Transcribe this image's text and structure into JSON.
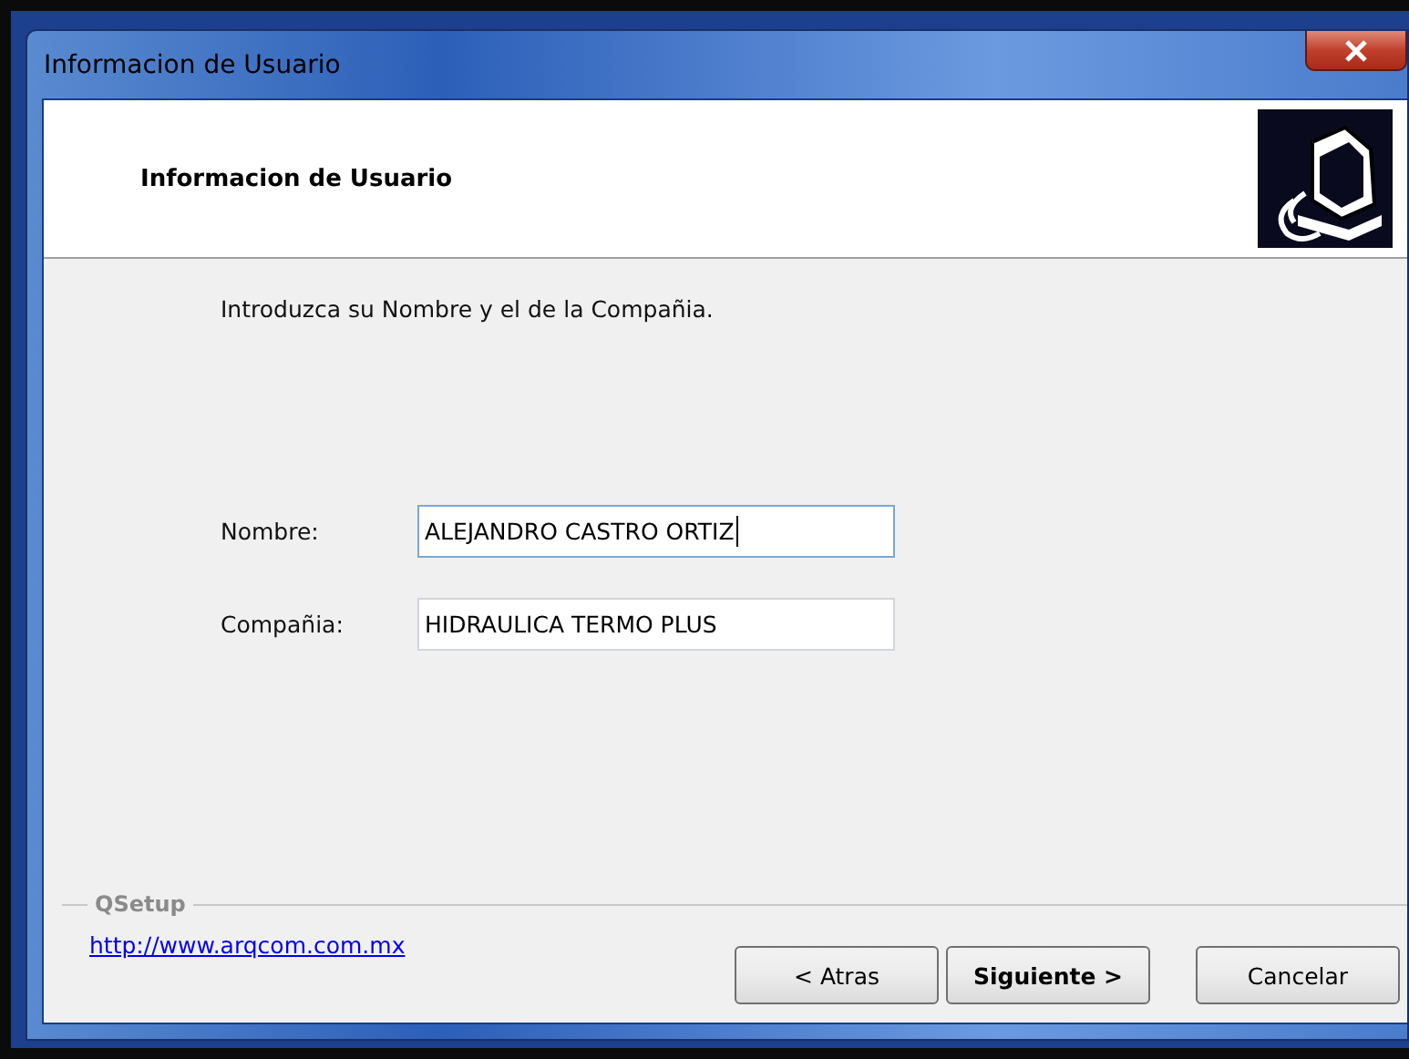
{
  "window": {
    "title": "Informacion de Usuario"
  },
  "header": {
    "title": "Informacion de Usuario"
  },
  "intro": "Introduzca su Nombre y el de la Compañia.",
  "fields": [
    {
      "label": "Nombre:",
      "value": "ALEJANDRO CASTRO ORTIZ",
      "focused": true
    },
    {
      "label": "Compañia:",
      "value": "HIDRAULICA TERMO PLUS",
      "focused": false
    }
  ],
  "footer": {
    "group_label": "QSetup",
    "link": "http://www.arqcom.com.mx"
  },
  "buttons": [
    {
      "label": "< Atras",
      "default": false
    },
    {
      "label": "Siguiente >",
      "default": true
    },
    {
      "label": "Cancelar",
      "default": false
    }
  ]
}
